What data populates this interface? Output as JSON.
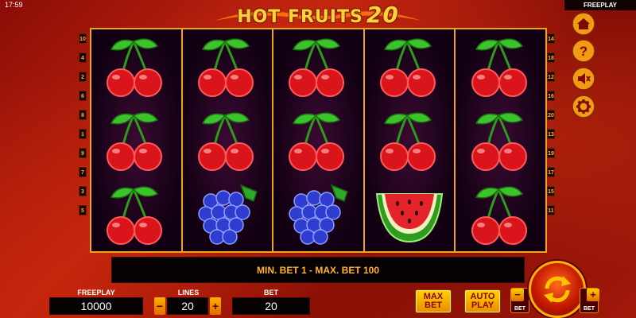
{
  "status": {
    "time": "17:59",
    "mode": "FREEPLAY"
  },
  "logo": {
    "word": "HOT FRUITS",
    "number": "20"
  },
  "reels": [
    [
      "cherry",
      "cherry",
      "cherry"
    ],
    [
      "cherry",
      "cherry",
      "grapes"
    ],
    [
      "cherry",
      "cherry",
      "grapes"
    ],
    [
      "cherry",
      "cherry",
      "watermelon"
    ],
    [
      "cherry",
      "cherry",
      "cherry"
    ]
  ],
  "paylines": {
    "left": [
      "10",
      "4",
      "2",
      "6",
      "8",
      "1",
      "9",
      "7",
      "3",
      "5"
    ],
    "right": [
      "14",
      "18",
      "12",
      "16",
      "20",
      "13",
      "19",
      "17",
      "15",
      "11"
    ]
  },
  "side_menu": {
    "icons": [
      "home-icon",
      "help-icon",
      "sound-muted-icon",
      "settings-icon"
    ]
  },
  "message": "MIN. BET 1 - MAX. BET 100",
  "bottom": {
    "balance_label": "FREEPLAY",
    "balance_value": "10000",
    "lines_label": "LINES",
    "lines_value": "20",
    "bet_label": "BET",
    "bet_value": "20",
    "minus": "−",
    "plus": "+",
    "maxbet": [
      "MAX",
      "BET"
    ],
    "autoplay": [
      "AUTO",
      "PLAY"
    ],
    "bet_down_label": "BET",
    "bet_up_label": "BET"
  },
  "colors": {
    "accent": "#f0a321",
    "text_highlight": "#ffb42a"
  }
}
